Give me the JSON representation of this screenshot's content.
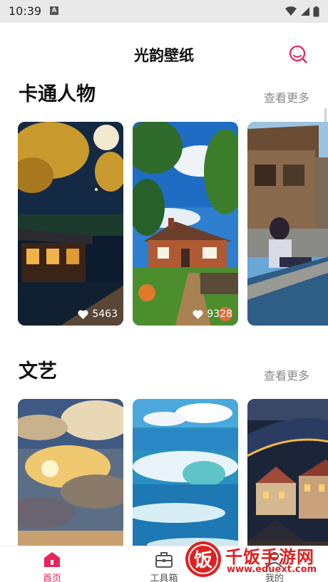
{
  "status_bar": {
    "time": "10:39",
    "notification_icon": "a-box-icon"
  },
  "header": {
    "title": "光韵壁纸",
    "search_icon": "search-icon"
  },
  "sections": [
    {
      "title": "卡通人物",
      "more_label": "查看更多",
      "cards": [
        {
          "scene": "night-pagoda-moon",
          "likes": "5463"
        },
        {
          "scene": "cottage-garden",
          "likes": "9328"
        },
        {
          "scene": "girl-canal-reading",
          "likes": ""
        }
      ]
    },
    {
      "title": "文艺",
      "more_label": "查看更多",
      "cards": [
        {
          "scene": "sunlit-clouds"
        },
        {
          "scene": "ocean-waves"
        },
        {
          "scene": "city-night-coast"
        }
      ]
    }
  ],
  "tabs": [
    {
      "label": "首页",
      "icon": "home-icon",
      "active": true
    },
    {
      "label": "工具箱",
      "icon": "toolbox-icon",
      "active": false
    },
    {
      "label": "我的",
      "icon": "profile-icon",
      "active": false
    }
  ],
  "watermark": {
    "name": "千饭手游网",
    "url": "www.eduext.com",
    "logo_text": "饭"
  },
  "colors": {
    "accent": "#e8245c",
    "muted_text": "#8a8a8a",
    "watermark": "#e02020"
  }
}
